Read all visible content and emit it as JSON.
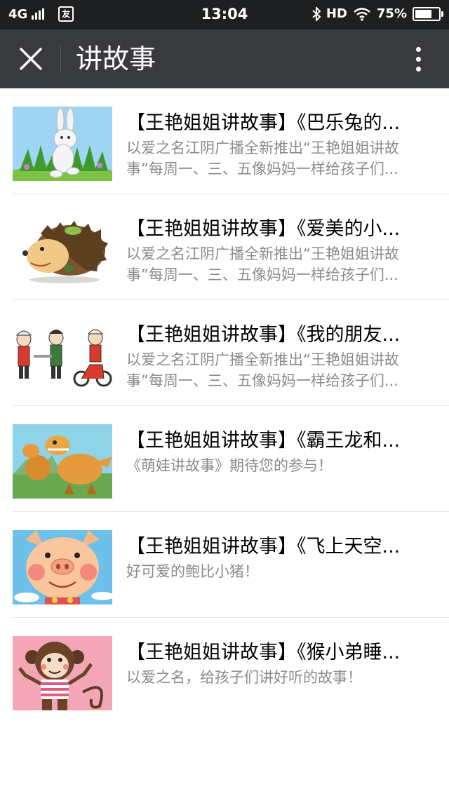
{
  "status_bar": {
    "network": "4G",
    "notification_glyph": "友",
    "time": "13:04",
    "hd_label": "HD",
    "battery_percent": "75%",
    "battery_level": 0.75
  },
  "nav": {
    "title": "讲故事"
  },
  "articles": [
    {
      "title": "【王艳姐姐讲故事】《巴乐兔的...",
      "desc": "以爱之名江阴广播全新推出“王艳姐姐讲故事”每周一、三、五像妈妈一样给孩子们...",
      "thumb_icon": "rabbit-illustration"
    },
    {
      "title": "【王艳姐姐讲故事】《爱美的小...",
      "desc": "以爱之名江阴广播全新推出“王艳姐姐讲故事”每周一、三、五像妈妈一样给孩子们...",
      "thumb_icon": "hedgehog-illustration"
    },
    {
      "title": "【王艳姐姐讲故事】《我的朋友...",
      "desc": "以爱之名江阴广播全新推出“王艳姐姐讲故事”每周一、三、五像妈妈一样给孩子们...",
      "thumb_icon": "firefighters-illustration"
    },
    {
      "title": "【王艳姐姐讲故事】《霸王龙和...",
      "desc": "《萌娃讲故事》期待您的参与！",
      "thumb_icon": "dinosaurs-illustration"
    },
    {
      "title": "【王艳姐姐讲故事】《飞上天空...",
      "desc": "好可爱的鲍比小猪！",
      "thumb_icon": "pig-illustration"
    },
    {
      "title": "【王艳姐姐讲故事】《猴小弟睡...",
      "desc": "以爱之名，给孩子们讲好听的故事！",
      "thumb_icon": "monkey-illustration"
    }
  ]
}
